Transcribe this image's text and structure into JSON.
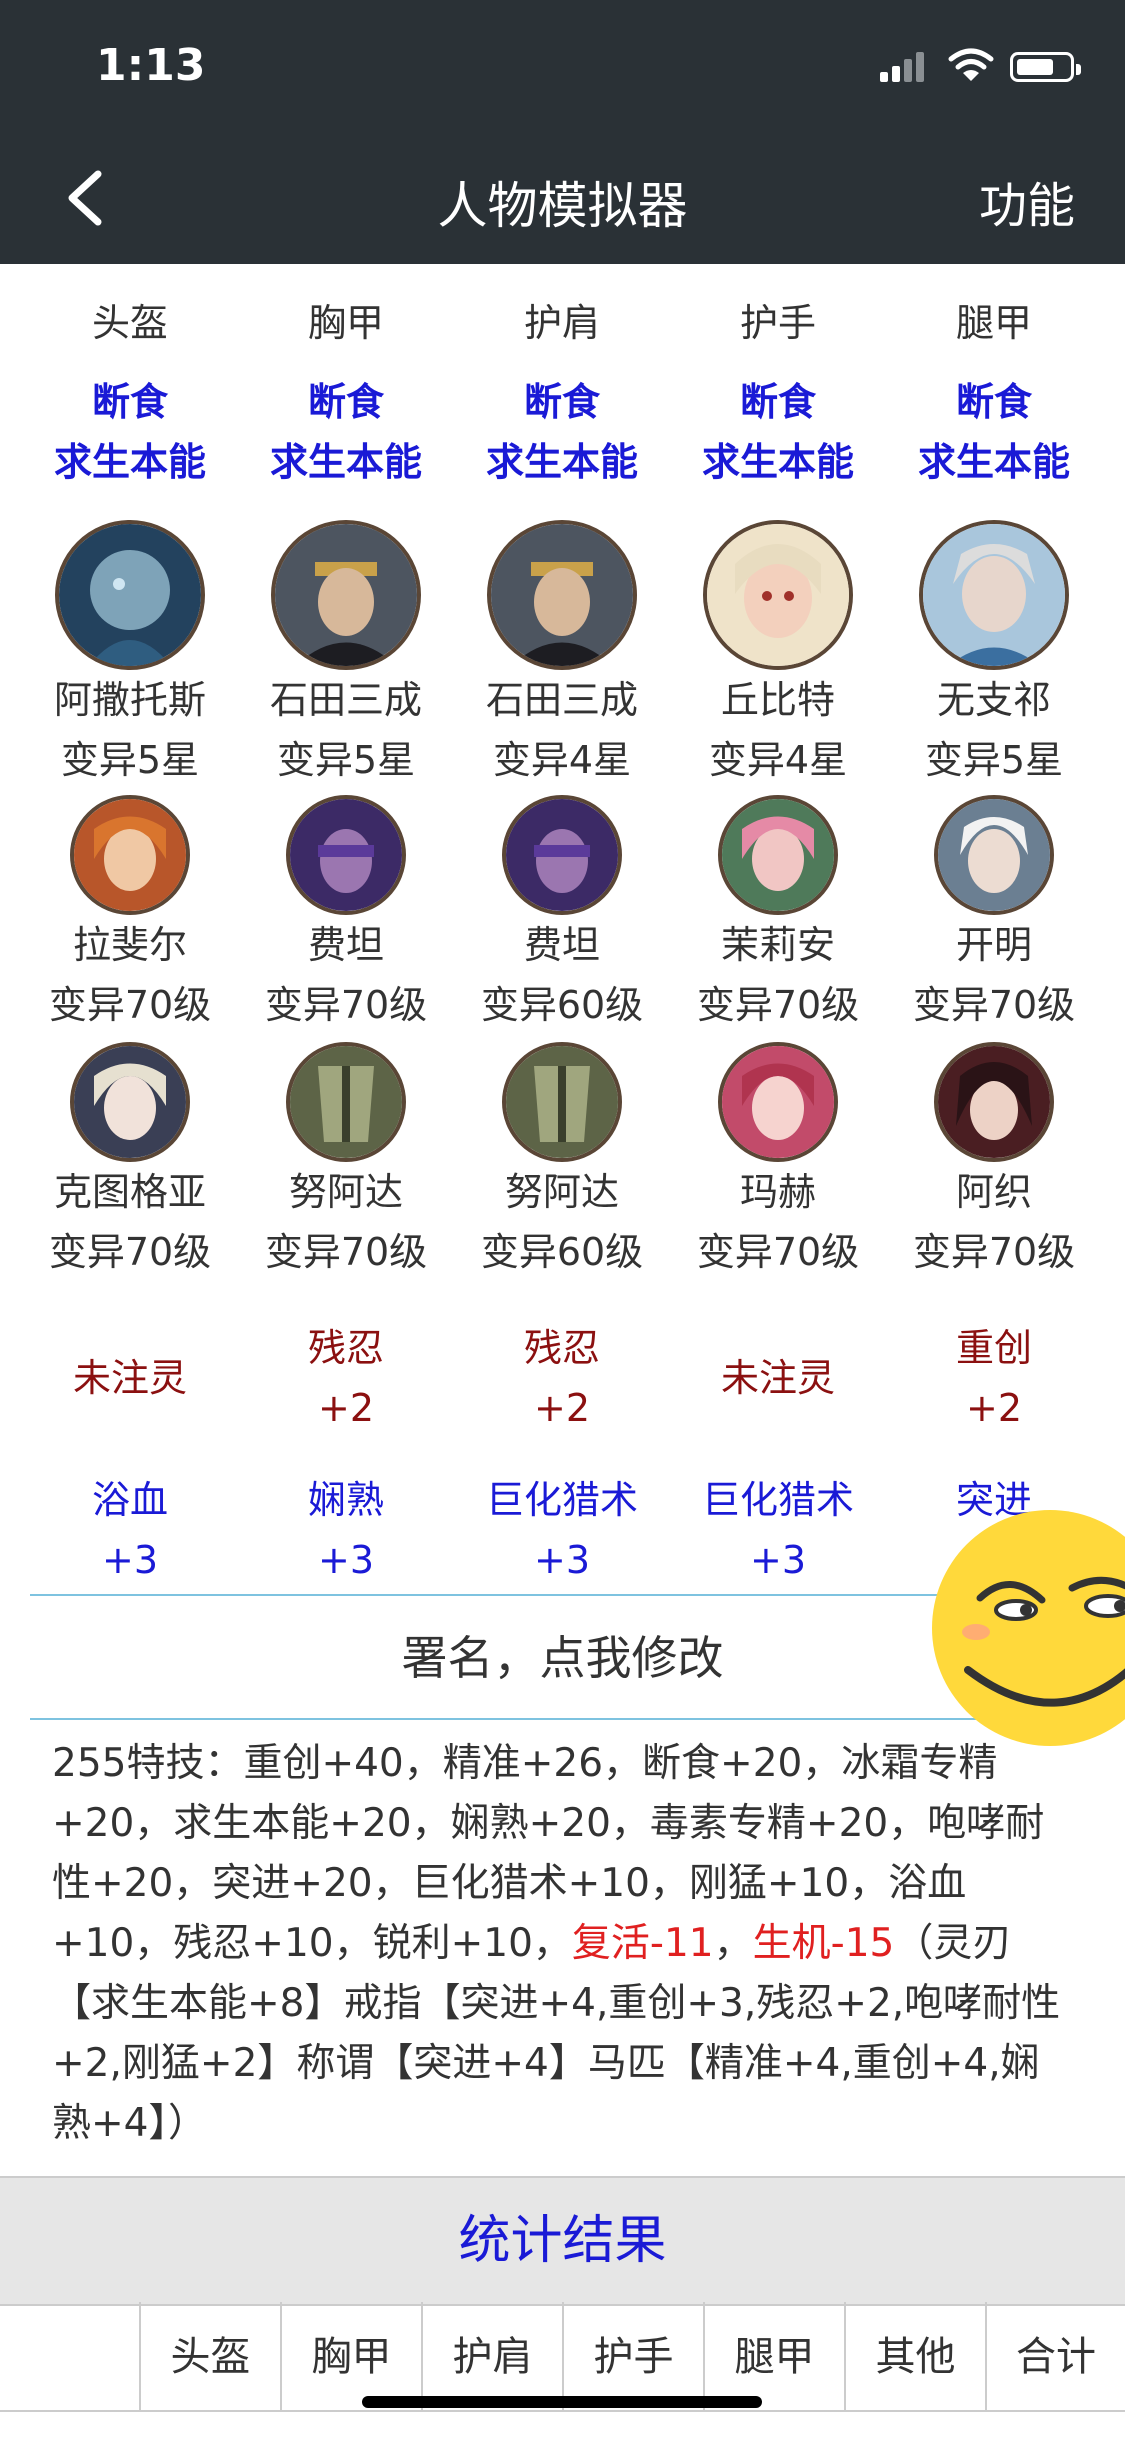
{
  "status": {
    "time": "1:13"
  },
  "nav": {
    "title": "人物模拟器",
    "right": "功能"
  },
  "slots": [
    "头盔",
    "胸甲",
    "护肩",
    "护手",
    "腿甲"
  ],
  "enchant": [
    [
      "断食",
      "求生本能"
    ],
    [
      "断食",
      "求生本能"
    ],
    [
      "断食",
      "求生本能"
    ],
    [
      "断食",
      "求生本能"
    ],
    [
      "断食",
      "求生本能"
    ]
  ],
  "hero_rows": [
    [
      {
        "name": "阿撒托斯",
        "rank": "变异5星"
      },
      {
        "name": "石田三成",
        "rank": "变异5星"
      },
      {
        "name": "石田三成",
        "rank": "变异4星"
      },
      {
        "name": "丘比特",
        "rank": "变异4星"
      },
      {
        "name": "无支祁",
        "rank": "变异5星"
      }
    ],
    [
      {
        "name": "拉斐尔",
        "rank": "变异70级"
      },
      {
        "name": "费坦",
        "rank": "变异70级"
      },
      {
        "name": "费坦",
        "rank": "变异60级"
      },
      {
        "name": "茉莉安",
        "rank": "变异70级"
      },
      {
        "name": "开明",
        "rank": "变异70级"
      }
    ],
    [
      {
        "name": "克图格亚",
        "rank": "变异70级"
      },
      {
        "name": "努阿达",
        "rank": "变异70级"
      },
      {
        "name": "努阿达",
        "rank": "变异60级"
      },
      {
        "name": "玛赫",
        "rank": "变异70级"
      },
      {
        "name": "阿织",
        "rank": "变异70级"
      }
    ]
  ],
  "bonus_row1": [
    {
      "a": "未注灵",
      "b": ""
    },
    {
      "a": "残忍",
      "b": "+2"
    },
    {
      "a": "残忍",
      "b": "+2"
    },
    {
      "a": "未注灵",
      "b": ""
    },
    {
      "a": "重创",
      "b": "+2"
    }
  ],
  "bonus_row2": [
    {
      "a": "浴血",
      "b": "+3"
    },
    {
      "a": "娴熟",
      "b": "+3"
    },
    {
      "a": "巨化猎术",
      "b": "+3"
    },
    {
      "a": "巨化猎术",
      "b": "+3"
    },
    {
      "a": "突进",
      "b": ""
    }
  ],
  "signature": "署名，点我修改",
  "summary": {
    "part1": "255特技：重创+40，精准+26，断食+20，冰霜专精+20，求生本能+20，娴熟+20，毒素专精+20，咆哮耐性+20，突进+20，巨化猎术+10，刚猛+10，浴血+10，残忍+10，锐利+10，",
    "red1": "复活-11",
    "sep": "，",
    "red2": "生机-15",
    "part2": "（灵刃【求生本能+8】戒指【突进+4,重创+3,残忍+2,咆哮耐性+2,刚猛+2】称谓【突进+4】马匹【精准+4,重创+4,娴熟+4】）"
  },
  "stats": {
    "title": "统计结果",
    "columns": [
      "",
      "头盔",
      "胸甲",
      "护肩",
      "护手",
      "腿甲",
      "其他",
      "合计"
    ]
  }
}
